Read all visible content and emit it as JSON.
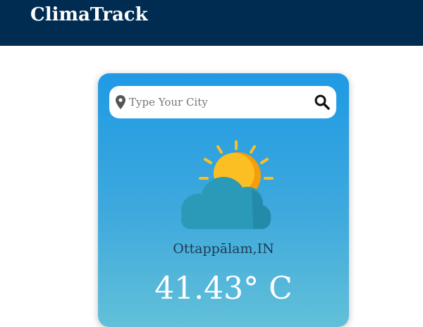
{
  "app": {
    "brand": "ClimaTrack"
  },
  "search": {
    "placeholder": "Type Your City",
    "value": ""
  },
  "weather": {
    "icon": "partly-cloudy-icon",
    "city": "Ottappālam,IN",
    "temperature": "41.43° C"
  },
  "colors": {
    "navbar": "#002c52",
    "card_top": "#1f9ae4",
    "card_bottom": "#62c0d8",
    "sun": "#fbbf24",
    "cloud": "#2a9ab8"
  }
}
